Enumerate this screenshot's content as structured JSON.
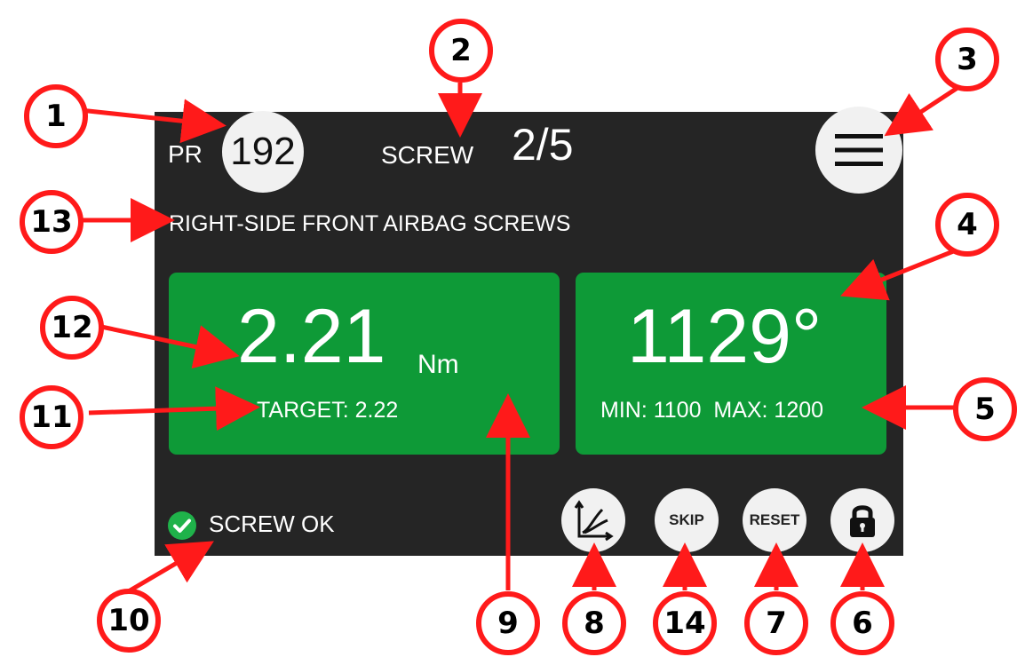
{
  "header": {
    "pr_label": "PR",
    "pr_number": "192",
    "screw_label": "SCREW",
    "screw_count": "2/5"
  },
  "job": {
    "title": "RIGHT-SIDE FRONT AIRBAG SCREWS"
  },
  "torque": {
    "value": "2.21",
    "unit": "Nm",
    "target_text": "TARGET: 2.22"
  },
  "angle": {
    "value": "1129°",
    "limits_text": "MIN: 1100  MAX: 1200"
  },
  "status": {
    "text": "SCREW OK",
    "icon": "check-circle-icon"
  },
  "buttons": {
    "chart_icon": "chart-icon",
    "skip_label": "SKIP",
    "reset_label": "RESET",
    "lock_icon": "lock-icon",
    "menu_icon": "hamburger-menu-icon"
  },
  "callouts": [
    "1",
    "2",
    "3",
    "4",
    "5",
    "6",
    "7",
    "8",
    "9",
    "10",
    "11",
    "12",
    "13",
    "14"
  ],
  "colors": {
    "screen_bg": "#252525",
    "panel_green": "#0e9a37",
    "button_bg": "#f1f1f1",
    "callout_red": "#ff1a1a"
  }
}
